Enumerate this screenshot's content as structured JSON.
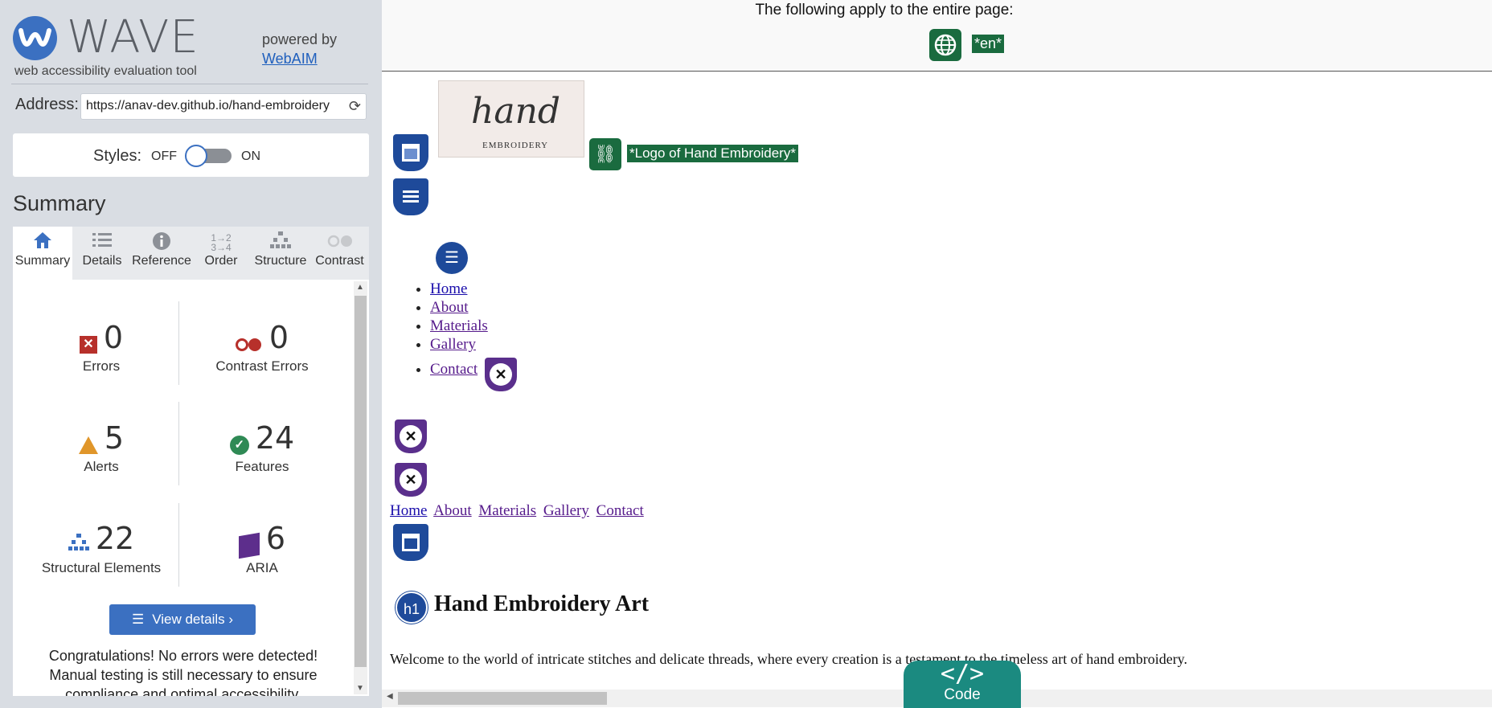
{
  "sidebar": {
    "logo_word": "WAVE",
    "tagline": "web accessibility evaluation tool",
    "powered_by": "powered by",
    "powered_link": "WebAIM",
    "address_label": "Address:",
    "address_value": "https://anav-dev.github.io/hand-embroidery",
    "styles_label": "Styles:",
    "styles_off": "OFF",
    "styles_on": "ON",
    "summary_heading": "Summary",
    "tabs": [
      {
        "label": "Summary",
        "icon": "home-icon",
        "active": true
      },
      {
        "label": "Details",
        "icon": "list-icon"
      },
      {
        "label": "Reference",
        "icon": "info-icon"
      },
      {
        "label": "Order",
        "icon": "order-icon"
      },
      {
        "label": "Structure",
        "icon": "structure-icon"
      },
      {
        "label": "Contrast",
        "icon": "contrast-icon"
      }
    ],
    "stats": {
      "errors": {
        "value": "0",
        "label": "Errors"
      },
      "contrast_errors": {
        "value": "0",
        "label": "Contrast Errors"
      },
      "alerts": {
        "value": "5",
        "label": "Alerts"
      },
      "features": {
        "value": "24",
        "label": "Features"
      },
      "structural": {
        "value": "22",
        "label": "Structural Elements"
      },
      "aria": {
        "value": "6",
        "label": "ARIA"
      }
    },
    "view_details": "View details ›",
    "congrats": "Congratulations! No errors were detected! Manual testing is still necessary to ensure compliance and optimal accessibility."
  },
  "page": {
    "top_text": "The following apply to the entire page:",
    "lang_label": "*en*",
    "logo_hand": "hand",
    "logo_embroidery": "EMBROIDERY",
    "logo_alt": "*Logo of Hand Embroidery*",
    "nav_list": [
      "Home",
      "About",
      "Materials",
      "Gallery",
      "Contact"
    ],
    "h_nav": [
      "Home",
      "About",
      "Materials",
      "Gallery",
      "Contact"
    ],
    "h1_badge": "h1",
    "heading": "Hand Embroidery Art",
    "paragraph": "Welcome to the world of intricate stitches and delicate threads, where every creation is a testament to the timeless art of hand embroidery.",
    "code_symbol": "</>",
    "code_label": "Code"
  },
  "colors": {
    "wave_blue": "#3b70c1",
    "error_red": "#b7302b",
    "alert_orange": "#e0962a",
    "feature_green": "#2f8a55",
    "aria_purple": "#5d2e8c",
    "code_teal": "#1b8a80"
  }
}
